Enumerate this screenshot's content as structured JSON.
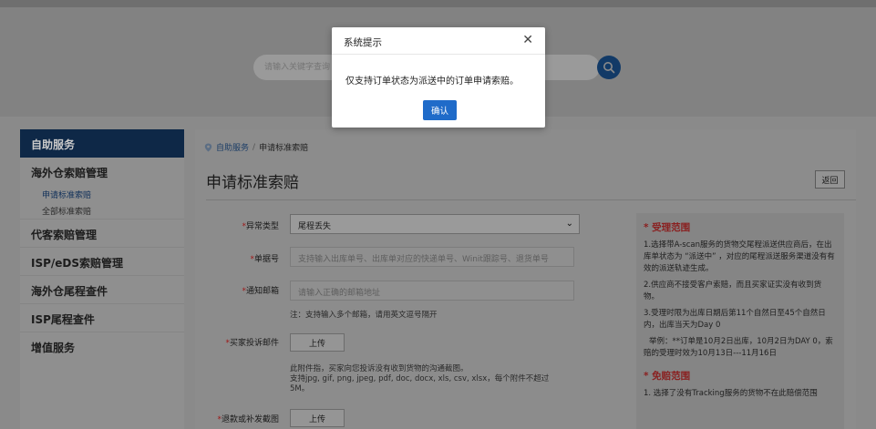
{
  "search": {
    "placeholder": "请输入关键字查询"
  },
  "sidebar": {
    "header": "自助服务",
    "groups": [
      {
        "label": "海外仓索赔管理"
      },
      {
        "label": "代客索赔管理"
      },
      {
        "label": "ISP/eDS索赔管理"
      },
      {
        "label": "海外仓尾程查件"
      },
      {
        "label": "ISP尾程查件"
      },
      {
        "label": "增值服务"
      }
    ],
    "sub_items": [
      {
        "label": "申请标准索赔"
      },
      {
        "label": "全部标准索赔"
      }
    ]
  },
  "breadcrumb": {
    "home": "自助服务",
    "separator": "/",
    "current": "申请标准索赔"
  },
  "page": {
    "title": "申请标准索赔",
    "back_label": "返回"
  },
  "form": {
    "exception_type": {
      "label": "异常类型",
      "value": "尾程丢失"
    },
    "order_no": {
      "label": "单据号",
      "placeholder": "支持输入出库单号、出库单对应的快递单号、Winit跟踪号、退货单号"
    },
    "email": {
      "label": "通知邮箱",
      "placeholder": "请输入正确的邮箱地址",
      "hint": "注：支持输入多个邮箱，请用英文逗号隔开"
    },
    "complaint_mail": {
      "label": "买家投诉邮件",
      "upload_label": "上传",
      "hint_line1": "此附件指，买家向您投诉没有收到货物的沟通截图。",
      "hint_line2": "支持jpg, gif, png, jpeg, pdf, doc, docx, xls, csv, xlsx，每个附件不超过",
      "hint_line3": "5M。"
    },
    "refund_screenshot": {
      "label": "退款或补发截图",
      "upload_label": "上传"
    },
    "required_mark": "*"
  },
  "info": {
    "scope_title": "* 受理范围",
    "scope_p1": "1.选择带A-scan服务的货物交尾程派送供应商后，在出库单状态为 “派送中” ，对应的尾程派送服务渠道没有有效的派送轨迹生成。",
    "scope_p2": "2.供应商不接受客户索赔，而且买家证实没有收到货物。",
    "scope_p3": "3.受理时限为出库日期后第11个自然日至45个自然日内，出库当天为Day 0",
    "scope_p4": "举例：**订单是10月2日出库，10月2日为DAY 0，索赔的受理时效为10月13日---11月16日",
    "exempt_title": "* 免赔范围",
    "exempt_p1": "1. 选择了没有Tracking服务的货物不在此赔偿范围"
  },
  "modal": {
    "title": "系统提示",
    "message": "仅支持订单状态为派送中的订单申请索赔。",
    "ok_label": "确认"
  },
  "colors": {
    "accent": "#1f6bc9",
    "sidebar_header": "#0e2847",
    "required": "#9e1818"
  }
}
